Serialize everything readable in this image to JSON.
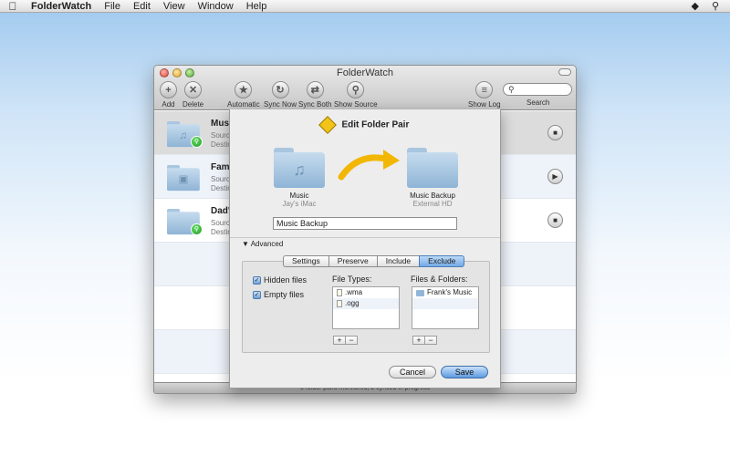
{
  "menubar": {
    "app_name": "FolderWatch",
    "items": [
      "File",
      "Edit",
      "View",
      "Window",
      "Help"
    ]
  },
  "window": {
    "title": "FolderWatch",
    "toolbar": {
      "add": "Add",
      "delete": "Delete",
      "automatic": "Automatic",
      "sync_now": "Sync Now",
      "sync_both": "Sync Both",
      "show_source": "Show Source",
      "show_log": "Show Log",
      "search": "Search",
      "search_value": ""
    },
    "rows": [
      {
        "name": "Music Backup",
        "line1": "Source:",
        "line2": "Destination:",
        "control": "stop"
      },
      {
        "name": "Family Photos",
        "line1": "Source:",
        "line2": "Destination:",
        "control": "play"
      },
      {
        "name": "Dad's Wordpress",
        "line1": "Source:",
        "line2": "Destination:",
        "control": "stop"
      }
    ],
    "status": "3 folder pairs monitored, 2 synced in progress"
  },
  "sheet": {
    "title": "Edit Folder Pair",
    "source": {
      "name": "Music",
      "location": "Jay's iMac"
    },
    "destination": {
      "name": "Music Backup",
      "location": "External HD"
    },
    "pair_name": "Music Backup",
    "advanced_label": "Advanced",
    "tabs": [
      "Settings",
      "Preserve",
      "Include",
      "Exclude"
    ],
    "active_tab": "Exclude",
    "checkboxes": [
      {
        "label": "Hidden files",
        "checked": true
      },
      {
        "label": "Empty files",
        "checked": true
      }
    ],
    "file_types_label": "File Types:",
    "file_types": [
      ".wma",
      ".ogg"
    ],
    "files_folders_label": "Files & Folders:",
    "files_folders": [
      "Frank's Music"
    ],
    "cancel": "Cancel",
    "save": "Save"
  },
  "colors": {
    "accent": "#5d9ae0",
    "green_badge": "#1c9a1c",
    "arrow": "#f2b705"
  }
}
